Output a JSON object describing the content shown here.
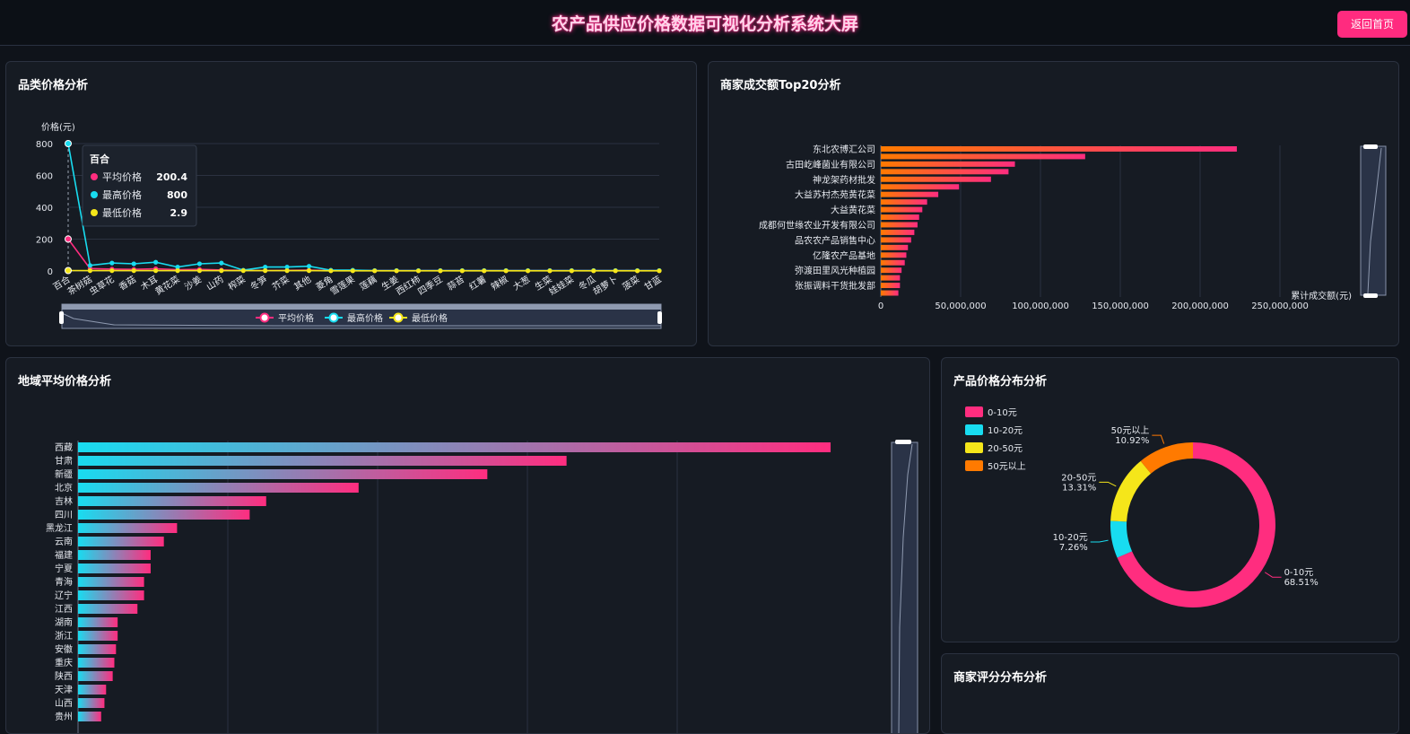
{
  "header": {
    "title": "农产品供应价格数据可视化分析系统大屏",
    "back_button": "返回首页"
  },
  "colors": {
    "pink": "#ff2d7f",
    "cyan": "#18dcf0",
    "yellow": "#f5e61a",
    "orange": "#ff7a00"
  },
  "panels": {
    "category": "品类价格分析",
    "merchant": "商家成交额Top20分析",
    "region": "地域平均价格分析",
    "distribution": "产品价格分布分析",
    "rating": "商家评分分布分析"
  },
  "chart_data": [
    {
      "id": "category_price",
      "type": "line",
      "ylabel": "价格(元)",
      "ylim": [
        0,
        800
      ],
      "yticks": [
        0,
        200,
        400,
        600,
        800
      ],
      "categories": [
        "百合",
        "茶树菇",
        "虫草花",
        "香菇",
        "木耳",
        "黄花菜",
        "沙姜",
        "山药",
        "榨菜",
        "冬笋",
        "芥菜",
        "其他",
        "菱角",
        "雪莲果",
        "莲藕",
        "生姜",
        "西红柿",
        "四季豆",
        "蒜苔",
        "红薯",
        "辣椒",
        "大葱",
        "生菜",
        "娃娃菜",
        "冬瓜",
        "胡萝卜",
        "菠菜",
        "甘蓝"
      ],
      "series": [
        {
          "name": "平均价格",
          "color": "#ff2d7f",
          "values": [
            200.4,
            15,
            12,
            10,
            14,
            8,
            10,
            6,
            4,
            3,
            4,
            5,
            3,
            3,
            2,
            2,
            2,
            2,
            2,
            2,
            2,
            2,
            2,
            2,
            2,
            2,
            2,
            2
          ]
        },
        {
          "name": "最高价格",
          "color": "#18dcf0",
          "values": [
            800,
            35,
            50,
            45,
            55,
            25,
            45,
            50,
            5,
            25,
            25,
            30,
            5,
            5,
            3,
            3,
            3,
            3,
            3,
            3,
            3,
            3,
            3,
            3,
            3,
            3,
            3,
            3
          ]
        },
        {
          "name": "最低价格",
          "color": "#f5e61a",
          "values": [
            2.9,
            2,
            2,
            2,
            2,
            2,
            2,
            2,
            2,
            2,
            2,
            2,
            1,
            1,
            1,
            1,
            1,
            1,
            1,
            1,
            1,
            1,
            1,
            1,
            1,
            1,
            1,
            1
          ]
        }
      ],
      "tooltip": {
        "title": "百合",
        "rows": [
          {
            "label": "平均价格",
            "value": "200.4",
            "color": "#ff2d7f"
          },
          {
            "label": "最高价格",
            "value": "800",
            "color": "#18dcf0"
          },
          {
            "label": "最低价格",
            "value": "2.9",
            "color": "#f5e61a"
          }
        ]
      },
      "legend": [
        "平均价格",
        "最高价格",
        "最低价格"
      ]
    },
    {
      "id": "merchant_top20",
      "type": "bar",
      "orientation": "horizontal",
      "xlabel": "累计成交额(元)",
      "xlim": [
        0,
        250000000
      ],
      "xticks": [
        "0",
        "50,000,000",
        "100,000,000",
        "150,000,000",
        "200,000,000",
        "250,000,000"
      ],
      "categories": [
        "东北农博汇公司",
        "",
        "古田屹峰菌业有限公司",
        "",
        "神龙架药材批发",
        "",
        "大益苏村杰苑黄花菜",
        "",
        "大益黄花菜",
        "",
        "成都何世缘农业开发有限公司",
        "",
        "品农农产品销售中心",
        "",
        "亿隆农产品基地",
        "",
        "弥渡田里风光种植园",
        "",
        "张振调料干货批发部",
        ""
      ],
      "values": [
        223000000,
        128000000,
        84000000,
        80000000,
        69000000,
        49000000,
        36000000,
        29000000,
        26000000,
        24000000,
        23000000,
        21000000,
        19000000,
        17000000,
        16000000,
        15000000,
        13000000,
        12000000,
        12000000,
        11000000
      ]
    },
    {
      "id": "region_avg",
      "type": "bar",
      "orientation": "horizontal",
      "xlim": [
        0,
        25
      ],
      "categories": [
        "西藏",
        "甘肃",
        "新疆",
        "北京",
        "吉林",
        "四川",
        "黑龙江",
        "云南",
        "福建",
        "宁夏",
        "青海",
        "辽宁",
        "江西",
        "湖南",
        "浙江",
        "安徽",
        "重庆",
        "陕西",
        "天津",
        "山西",
        "贵州"
      ],
      "values": [
        22.8,
        14.8,
        12.4,
        8.5,
        5.7,
        5.2,
        3.0,
        2.6,
        2.2,
        2.2,
        2.0,
        2.0,
        1.8,
        1.2,
        1.2,
        1.15,
        1.1,
        1.05,
        0.85,
        0.8,
        0.7
      ]
    },
    {
      "id": "price_distribution",
      "type": "pie",
      "legend": [
        "0-10元",
        "10-20元",
        "20-50元",
        "50元以上"
      ],
      "labels": [
        "0-10元",
        "10-20元",
        "20-50元",
        "50元以上"
      ],
      "values": [
        68.51,
        7.26,
        13.31,
        10.92
      ],
      "value_labels": [
        "68.51%",
        "7.26%",
        "13.31%",
        "10.92%"
      ],
      "colors": [
        "#ff2d7f",
        "#18dcf0",
        "#f5e61a",
        "#ff7a00"
      ]
    }
  ]
}
